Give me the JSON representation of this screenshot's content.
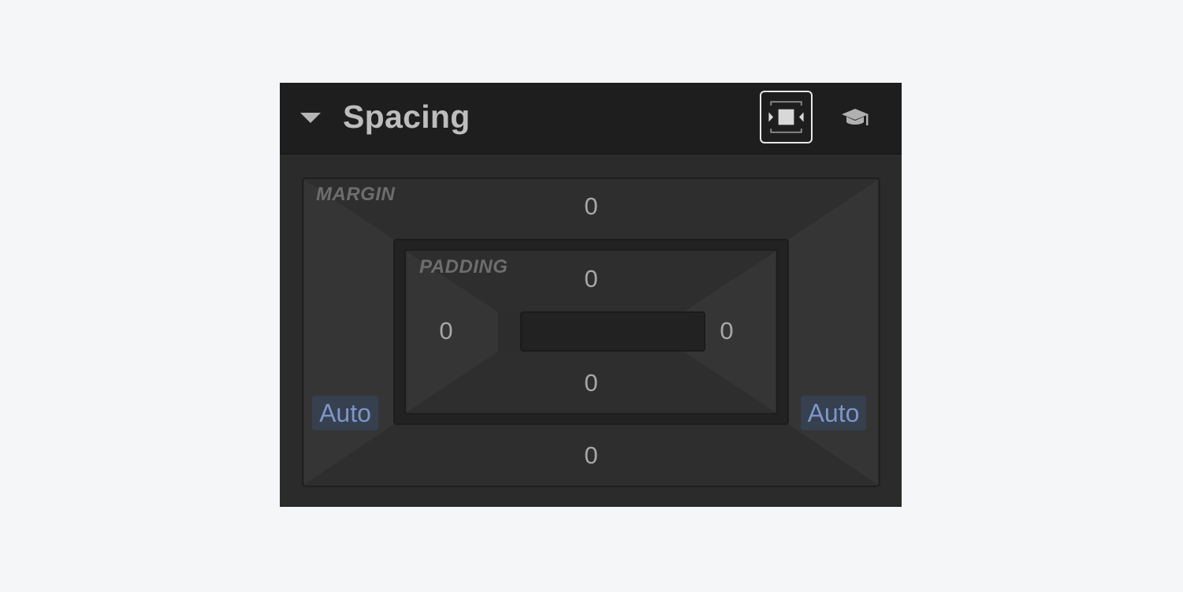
{
  "panel": {
    "title": "Spacing",
    "icons": {
      "collapse": "caret-down-icon",
      "spacing_preset": "spacing-box-icon",
      "learn": "graduation-cap-icon"
    }
  },
  "margin": {
    "label": "MARGIN",
    "top": "0",
    "bottom": "0",
    "left": "Auto",
    "right": "Auto"
  },
  "padding": {
    "label": "PADDING",
    "top": "0",
    "bottom": "0",
    "left": "0",
    "right": "0"
  },
  "colors": {
    "auto_text": "#7d95c9",
    "auto_bg": "#36404f",
    "header_bg": "#1e1e1e",
    "panel_bg": "#2b2b2b"
  }
}
